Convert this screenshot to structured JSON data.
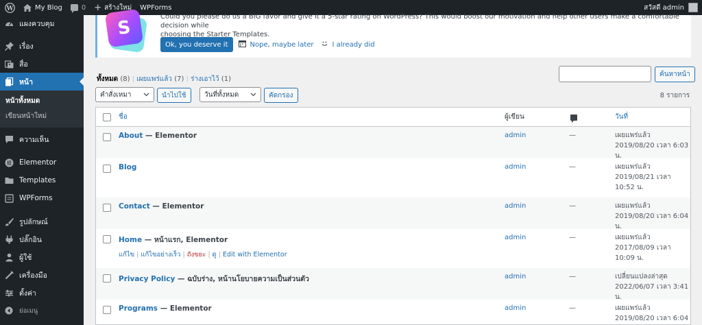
{
  "adminbar": {
    "site_name": "My Blog",
    "comments_count": "0",
    "new_label": "สร้างใหม่",
    "wpforms_label": "WPForms",
    "greeting": "สวัสดี admin"
  },
  "sidebar": {
    "items": [
      {
        "label": "แผงควบคุม",
        "icon": "dashboard-icon"
      },
      {
        "label": "เรื่อง",
        "icon": "pin-icon"
      },
      {
        "label": "สื่อ",
        "icon": "media-icon"
      },
      {
        "label": "หน้า",
        "icon": "pages-icon"
      },
      {
        "label": "ความเห็น",
        "icon": "comments-icon"
      },
      {
        "label": "Elementor",
        "icon": "elementor-icon"
      },
      {
        "label": "Templates",
        "icon": "folder-icon"
      },
      {
        "label": "WPForms",
        "icon": "wpforms-icon"
      },
      {
        "label": "รูปลักษณ์",
        "icon": "appearance-icon"
      },
      {
        "label": "ปลั๊กอิน",
        "icon": "plugins-icon"
      },
      {
        "label": "ผู้ใช้",
        "icon": "users-icon"
      },
      {
        "label": "เครื่องมือ",
        "icon": "tools-icon"
      },
      {
        "label": "ตั้งค่า",
        "icon": "settings-icon"
      },
      {
        "label": "ย่อเมนู",
        "icon": "collapse-icon"
      }
    ],
    "submenu": [
      "หน้าทั้งหมด",
      "เขียนหน้าใหม่"
    ]
  },
  "notice": {
    "logo_letter": "S",
    "line1": "Could you please do us a BIG favor and give it a 5-star rating on WordPress? This would boost our motivation and help other users make a comfortable decision while",
    "line2": "choosing the Starter Templates.",
    "ok_button": "Ok, you deserve it",
    "maybe_later": "Nope, maybe later",
    "already_did": "I already did"
  },
  "filters": {
    "all_label": "ทั้งหมด",
    "all_count": "(8)",
    "published_label": "เผยแพร่แล้ว",
    "published_count": "(7)",
    "draft_label": "ร่างเอาไว้",
    "draft_count": "(1)",
    "search_button": "ค้นหาหน้า",
    "bulk_action": "คำสั่งเหมา",
    "apply": "นำไปใช้",
    "all_dates": "วันที่ทั้งหมด",
    "filter_button": "คัดกรอง",
    "items_count": "8 รายการ"
  },
  "table": {
    "headers": {
      "title": "ชื่อ",
      "author": "ผู้เขียน",
      "date": "วันที่"
    },
    "rows": [
      {
        "title": "About",
        "state": " — Elementor",
        "author": "admin",
        "comments": "—",
        "status": "เผยแพร่แล้ว",
        "date": "2019/08/20 เวลา 6:03 น."
      },
      {
        "title": "Blog",
        "state": "",
        "author": "admin",
        "comments": "—",
        "status": "เผยแพร่แล้ว",
        "date": "2019/08/21 เวลา 10:52 น."
      },
      {
        "title": "Contact",
        "state": " — Elementor",
        "author": "admin",
        "comments": "—",
        "status": "เผยแพร่แล้ว",
        "date": "2019/08/20 เวลา 6:04 น."
      },
      {
        "title": "Home",
        "state": " — หน้าแรก, Elementor",
        "author": "admin",
        "comments": "—",
        "status": "เผยแพร่แล้ว",
        "date": "2017/08/09 เวลา 10:09 น."
      },
      {
        "title": "Privacy Policy",
        "state": " — ฉบับร่าง, หน้านโยบายความเป็นส่วนตัว",
        "author": "admin",
        "comments": "—",
        "status": "เปลี่ยนแปลงล่าสุด",
        "date": "2022/06/07 เวลา 3:41 น."
      },
      {
        "title": "Programs",
        "state": " — Elementor",
        "author": "admin",
        "comments": "—",
        "status": "เผยแพร่แล้ว",
        "date": "2019/08/20 เวลา 6:04 น."
      }
    ],
    "row_actions": {
      "edit": "แก้ไข",
      "quick_edit": "แก้ไขอย่างเร็ว",
      "trash": "ถังขยะ",
      "view": "ดู",
      "elementor": "Edit with Elementor"
    }
  }
}
